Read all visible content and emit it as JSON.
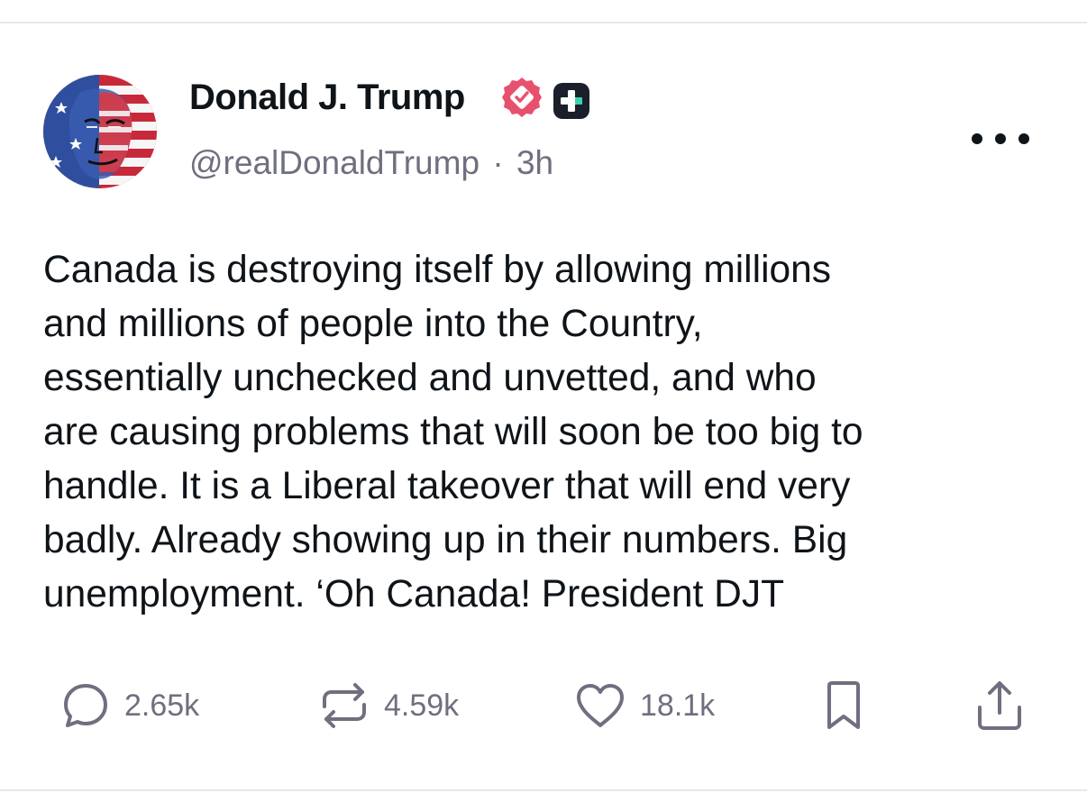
{
  "author": {
    "display_name": "Donald J. Trump",
    "handle": "@realDonaldTrump",
    "separator": "·",
    "time_ago": "3h",
    "avatar_icon": "flag-portrait-avatar",
    "verified_icon": "verified-badge-icon",
    "verified_color": "#e8516e",
    "plus_icon": "truth-plus-badge-icon"
  },
  "post": {
    "lines": [
      "Canada is destroying itself by allowing millions",
      "and millions of people into the Country,",
      "essentially unchecked and unvetted, and who",
      "are causing problems that will soon be too big to",
      "handle. It is a Liberal takeover that will end very",
      "badly. Already showing up in their numbers. Big",
      "unemployment. ‘Oh Canada! President DJT"
    ]
  },
  "actions": {
    "replies": {
      "count": "2.65k",
      "icon": "reply-icon"
    },
    "retruths": {
      "count": "4.59k",
      "icon": "retruth-icon"
    },
    "likes": {
      "count": "18.1k",
      "icon": "heart-icon"
    },
    "bookmark": {
      "icon": "bookmark-icon"
    },
    "share": {
      "icon": "share-icon"
    }
  },
  "colors": {
    "text": "#0f1419",
    "muted": "#6f6f7f",
    "divider": "#e7e7ec",
    "badge_pink": "#e8516e",
    "plus_dark": "#1b1e2b",
    "plus_teal": "#3ad2b5"
  }
}
